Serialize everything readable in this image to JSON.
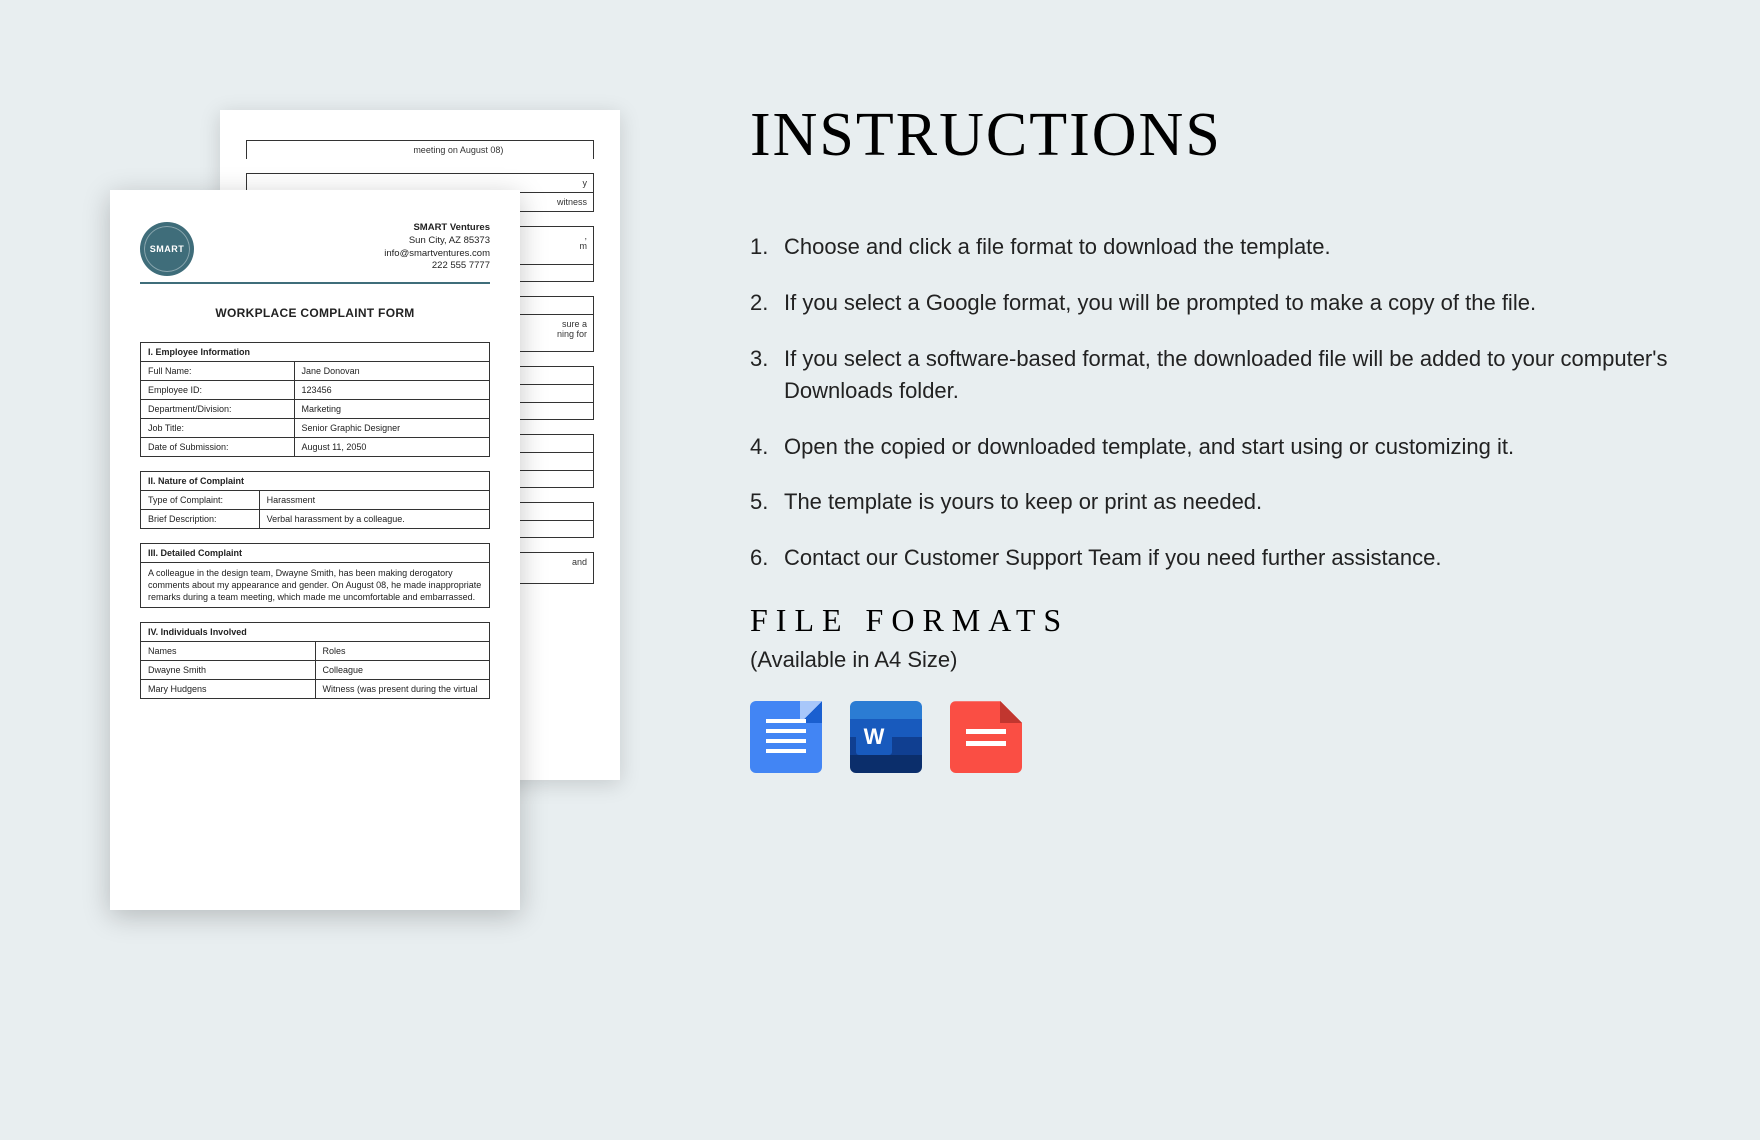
{
  "back_page": {
    "frag1": "meeting on August 08)",
    "frag2a": "y",
    "frag2b": "witness",
    "frag3a": ",",
    "frag3b": "m",
    "frag4a": "sure a",
    "frag4b": "ning for",
    "frag5": "and"
  },
  "company": {
    "logo_text": "SMART",
    "name": "SMART Ventures",
    "address": "Sun City, AZ 85373",
    "email": "info@smartventures.com",
    "phone": "222 555 7777"
  },
  "form": {
    "title": "WORKPLACE COMPLAINT FORM",
    "section1": {
      "heading": "I.    Employee Information",
      "rows": [
        {
          "label": "Full Name:",
          "value": "Jane Donovan"
        },
        {
          "label": "Employee ID:",
          "value": "123456"
        },
        {
          "label": "Department/Division:",
          "value": "Marketing"
        },
        {
          "label": "Job Title:",
          "value": "Senior Graphic Designer"
        },
        {
          "label": "Date of Submission:",
          "value": "August 11, 2050"
        }
      ]
    },
    "section2": {
      "heading": "II.    Nature of Complaint",
      "rows": [
        {
          "label": "Type of Complaint:",
          "value": "Harassment"
        },
        {
          "label": "Brief Description:",
          "value": "Verbal harassment by a colleague."
        }
      ]
    },
    "section3": {
      "heading": "III.    Detailed Complaint",
      "body": "A colleague in the design team, Dwayne Smith, has been making derogatory comments about my appearance and gender. On August 08, he made inappropriate remarks during a team meeting, which made me uncomfortable and embarrassed."
    },
    "section4": {
      "heading": "IV.    Individuals Involved",
      "cols": [
        "Names",
        "Roles"
      ],
      "rows": [
        {
          "a": "Dwayne Smith",
          "b": "Colleague"
        },
        {
          "a": "Mary Hudgens",
          "b": "Witness (was present during the virtual"
        }
      ]
    }
  },
  "instructions": {
    "title": "INSTRUCTIONS",
    "steps": [
      "Choose and click a file format to download the template.",
      "If you select a Google format, you will be prompted to make a copy of the file.",
      "If you select a software-based format, the downloaded file will be added to your computer's Downloads folder.",
      "Open the copied or downloaded template, and start using or customizing it.",
      "The template is yours to keep or print as needed.",
      "Contact our Customer Support Team if you need further assistance."
    ],
    "formats_title": "FILE FORMATS",
    "formats_sub": "(Available in A4 Size)"
  }
}
